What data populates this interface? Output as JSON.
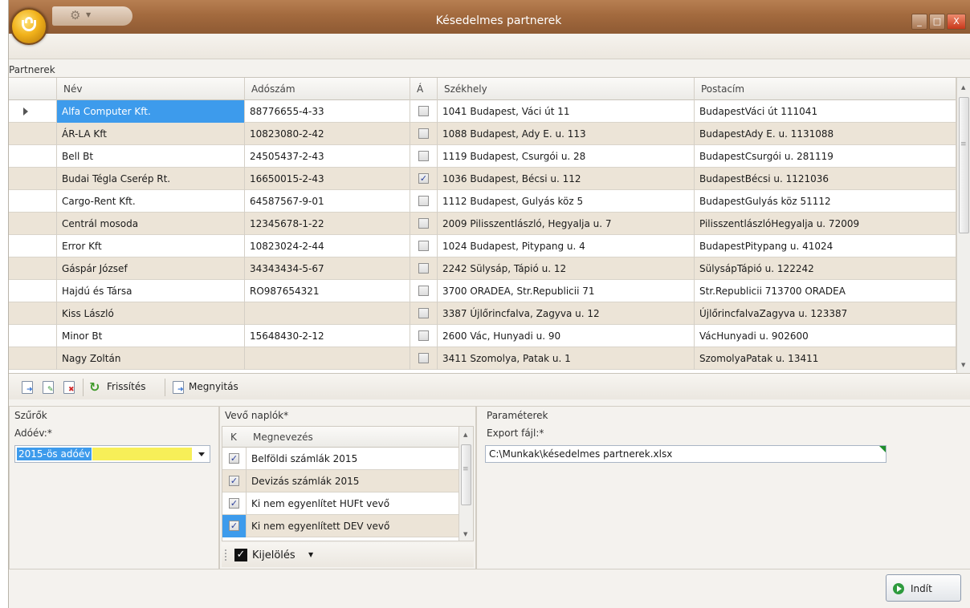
{
  "window": {
    "title": "Késedelmes partnerek",
    "min_glyph": "_",
    "max_glyph": "□",
    "close_glyph": "X"
  },
  "partners": {
    "group_label": "Partnerek",
    "columns": [
      "Név",
      "Adószám",
      "Á",
      "Székhely",
      "Postacím"
    ],
    "rows": [
      {
        "name": "Alfa Computer Kft.",
        "tax": "88776655-4-33",
        "checked": false,
        "seat": "1041 Budapest, Váci út 11",
        "postal": "BudapestVáci út 111041"
      },
      {
        "name": "ÁR-LA Kft",
        "tax": "10823080-2-42",
        "checked": false,
        "seat": "1088 Budapest, Ady E. u. 113",
        "postal": "BudapestAdy E. u. 1131088"
      },
      {
        "name": "Bell Bt",
        "tax": "24505437-2-43",
        "checked": false,
        "seat": "1119 Budapest, Csurgói u. 28",
        "postal": "BudapestCsurgói u. 281119"
      },
      {
        "name": "Budai Tégla Cserép Rt.",
        "tax": "16650015-2-43",
        "checked": true,
        "seat": "1036 Budapest, Bécsi u. 112",
        "postal": "BudapestBécsi u. 1121036"
      },
      {
        "name": "Cargo-Rent Kft.",
        "tax": "64587567-9-01",
        "checked": false,
        "seat": "1112 Budapest, Gulyás köz 5",
        "postal": "BudapestGulyás köz 51112"
      },
      {
        "name": "Centrál mosoda",
        "tax": "12345678-1-22",
        "checked": false,
        "seat": "2009 Pilisszentlászló, Hegyalja u. 7",
        "postal": "PilisszentlászlóHegyalja u. 72009"
      },
      {
        "name": "Error Kft",
        "tax": "10823024-2-44",
        "checked": false,
        "seat": "1024 Budapest, Pitypang u. 4",
        "postal": "BudapestPitypang u. 41024"
      },
      {
        "name": "Gáspár József",
        "tax": "34343434-5-67",
        "checked": false,
        "seat": "2242 Sülysáp, Tápió u. 12",
        "postal": "SülysápTápió u. 122242"
      },
      {
        "name": "Hajdú és Társa",
        "tax": "RO987654321",
        "checked": false,
        "seat": "3700 ORADEA, Str.Republicii 71",
        "postal": "Str.Republicii 713700 ORADEA"
      },
      {
        "name": "Kiss László",
        "tax": "",
        "checked": false,
        "seat": "3387 Újlőrincfalva, Zagyva u. 12",
        "postal": "ÚjlőrincfalvaZagyva u. 123387"
      },
      {
        "name": "Minor Bt",
        "tax": "15648430-2-12",
        "checked": false,
        "seat": "2600 Vác, Hunyadi u. 90",
        "postal": "VácHunyadi u. 902600"
      },
      {
        "name": "Nagy Zoltán",
        "tax": "",
        "checked": false,
        "seat": "3411 Szomolya, Patak u. 1",
        "postal": "SzomolyaPatak u. 13411"
      }
    ]
  },
  "toolbar": {
    "refresh_label": "Frissítés",
    "open_label": "Megnyitás"
  },
  "filters": {
    "title": "Szűrők",
    "year_label": "Adóév:*",
    "year_value": "2015-ös adóév"
  },
  "journals": {
    "title": "Vevő naplók*",
    "col_k": "K",
    "col_name": "Megnevezés",
    "items": [
      {
        "name": "Belföldi számlák 2015",
        "checked": true
      },
      {
        "name": "Devizás számlák 2015",
        "checked": true
      },
      {
        "name": "Ki nem egyenlítet HUFt vevő",
        "checked": true
      },
      {
        "name": "Ki nem egyenlített DEV vevő",
        "checked": true
      }
    ],
    "select_label": "Kijelölés"
  },
  "params": {
    "title": "Paraméterek",
    "export_label": "Export fájl:*",
    "export_value": "C:\\Munkak\\késedelmes partnerek.xlsx"
  },
  "start_button": "Indít",
  "colors": {
    "title_bar": "#a36a3e",
    "selection": "#3d9bec",
    "alt_row": "#ece4d7",
    "highlight_yellow": "#f7ef58"
  }
}
